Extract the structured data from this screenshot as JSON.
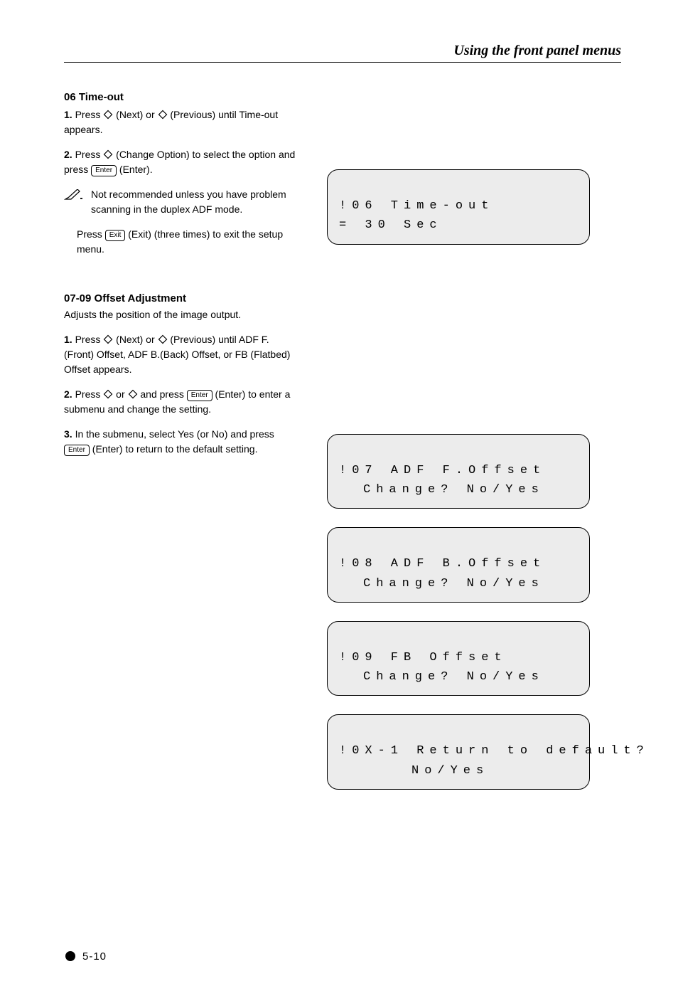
{
  "header": {
    "title": "Using the front panel menus"
  },
  "section_timeout": {
    "title": "06 Time-out",
    "steps": {
      "s1_num": "1.",
      "s1a": "Press ",
      "s1b": " (Next) or ",
      "s1c": " (Previous) until Time-out appears.",
      "s2_num": "2.",
      "s2a": "Press ",
      "s2b": " (Change Option) to select the option and press ",
      "s2c": " (Enter)."
    },
    "note_a": "Not recommended unless you have problem scanning in the duplex ADF mode.",
    "exit_a": "Press ",
    "exit_b": " (Exit) (three times) to exit the setup menu."
  },
  "section_offset": {
    "title": "07-09 Offset Adjustment",
    "desc": "Adjusts the position of the image output.",
    "steps": {
      "s1_num": "1.",
      "s1a": "Press ",
      "s1b": " (Next) or ",
      "s1c": " (Previous) until ADF F.(Front) Offset, ADF B.(Back) Offset, or FB (Flatbed) Offset appears.",
      "s2_num": "2.",
      "s2a": "Press ",
      "s2b": " or ",
      "s2c": " and press ",
      "s2d": " (Enter) to enter a submenu and change the setting.",
      "s3_num": "3.",
      "s3a": "In the submenu, select Yes (or No) and press ",
      "s3b": " (Enter) to return to the default setting."
    }
  },
  "lcd": {
    "timeout_l1": "!06 Time-out",
    "timeout_l2": "= 30 Sec",
    "adff_l1": "!07 ADF F.Offset",
    "adff_l2": "Change? No/Yes",
    "adfb_l1": "!08 ADF B.Offset",
    "adfb_l2": "Change? No/Yes",
    "fb_l1": "!09 FB Offset",
    "fb_l2": "Change? No/Yes",
    "ret_l1": "!0X-1 Return to default?",
    "ret_l2": "No/Yes"
  },
  "keys": {
    "enter": "Enter",
    "exit": "Exit"
  },
  "footer": {
    "page": "5-10"
  }
}
